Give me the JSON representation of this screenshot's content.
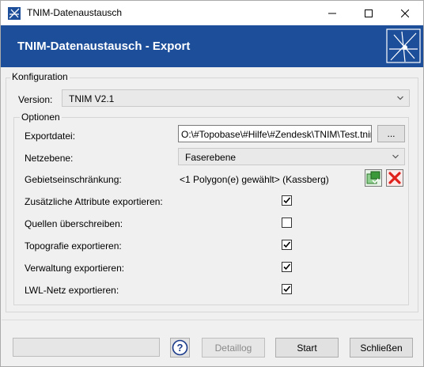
{
  "window": {
    "title": "TNIM-Datenaustausch"
  },
  "banner": {
    "title": "TNIM-Datenaustausch - Export"
  },
  "config": {
    "group_title": "Konfiguration",
    "version_label": "Version:",
    "version_value": "TNIM V2.1"
  },
  "options": {
    "group_title": "Optionen",
    "exportfile_label": "Exportdatei:",
    "exportfile_value": "O:\\#Topobase\\#Hilfe\\#Zendesk\\TNIM\\Test.tnim",
    "browse_label": "...",
    "netzebene_label": "Netzebene:",
    "netzebene_value": "Faserebene",
    "gebiet_label": "Gebietseinschränkung:",
    "gebiet_value": "<1 Polygon(e) gewählt> (Kassberg)",
    "checkboxes": [
      {
        "label": "Zusätzliche Attribute exportieren:",
        "checked": true
      },
      {
        "label": "Quellen überschreiben:",
        "checked": false
      },
      {
        "label": "Topografie exportieren:",
        "checked": true
      },
      {
        "label": "Verwaltung exportieren:",
        "checked": true
      },
      {
        "label": "LWL-Netz exportieren:",
        "checked": true
      }
    ]
  },
  "footer": {
    "help_label": "?",
    "detaillog_label": "Detaillog",
    "start_label": "Start",
    "close_label": "Schließen"
  },
  "colors": {
    "banner": "#1d4e9a",
    "delete_red": "#e0201b",
    "select_green": "#3a9a3a"
  }
}
